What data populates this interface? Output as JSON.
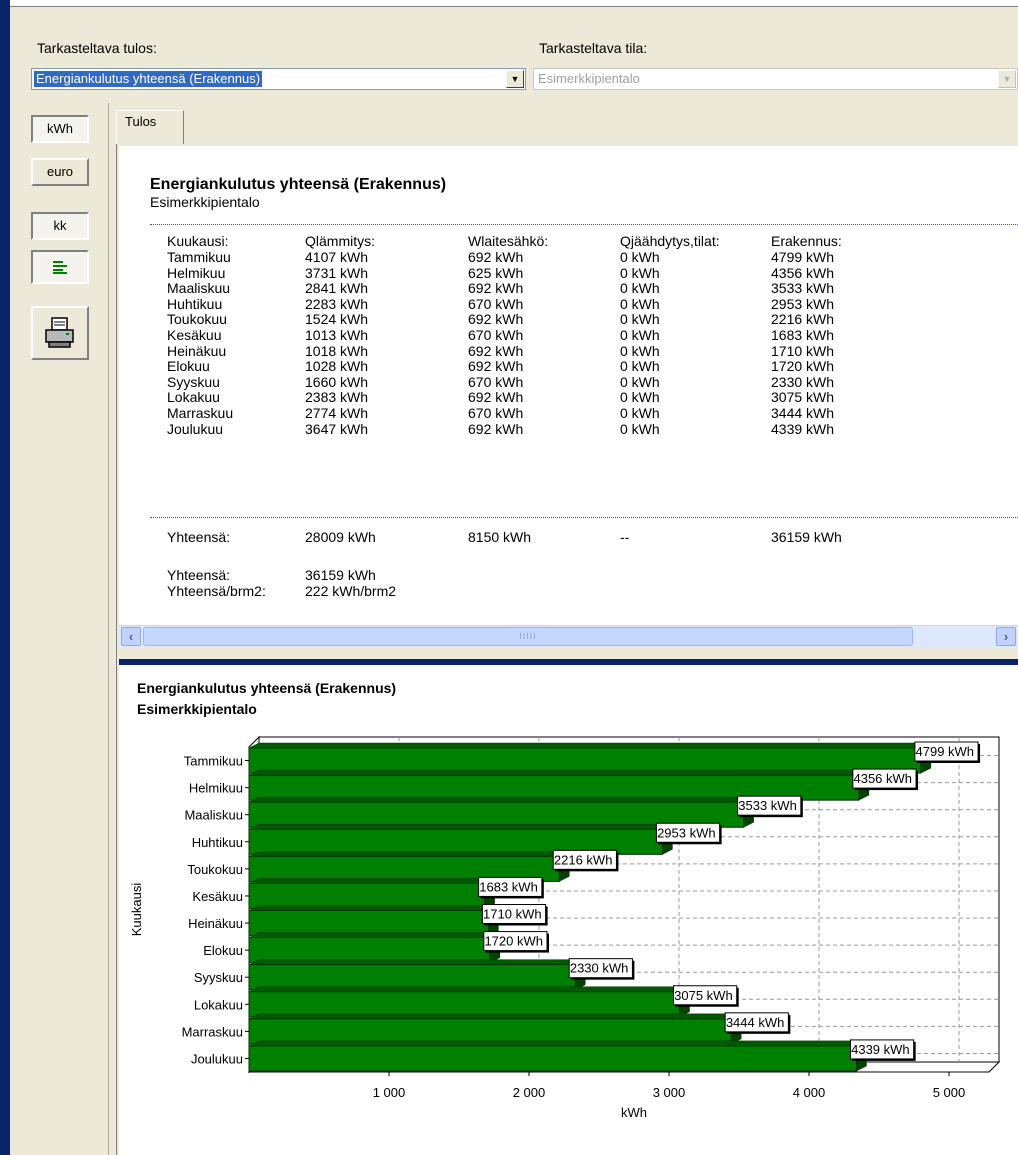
{
  "header": {
    "result_label": "Tarkasteltava tulos:",
    "result_value": "Energiankulutus yhteensä (Erakennus)",
    "space_label": "Tarkasteltava tila:",
    "space_value": "Esimerkkipientalo"
  },
  "sidebar": {
    "kwh_label": "kWh",
    "euro_label": "euro",
    "kk_label": "kk"
  },
  "tab": {
    "label": "Tulos"
  },
  "table": {
    "title": "Energiankulutus yhteensä (Erakennus)",
    "subtitle": "Esimerkkipientalo",
    "headers": [
      "Kuukausi:",
      "Qlämmitys:",
      "Wlaitesähkö:",
      "Qjäähdytys,tilat:",
      "Erakennus:"
    ],
    "rows": [
      [
        "Tammikuu",
        "4107 kWh",
        "692 kWh",
        "0 kWh",
        "4799 kWh"
      ],
      [
        "Helmikuu",
        "3731 kWh",
        "625 kWh",
        "0 kWh",
        "4356 kWh"
      ],
      [
        "Maaliskuu",
        "2841 kWh",
        "692 kWh",
        "0 kWh",
        "3533 kWh"
      ],
      [
        "Huhtikuu",
        "2283 kWh",
        "670 kWh",
        "0 kWh",
        "2953 kWh"
      ],
      [
        "Toukokuu",
        "1524 kWh",
        "692 kWh",
        "0 kWh",
        "2216 kWh"
      ],
      [
        "Kesäkuu",
        "1013 kWh",
        "670 kWh",
        "0 kWh",
        "1683 kWh"
      ],
      [
        "Heinäkuu",
        "1018 kWh",
        "692 kWh",
        "0 kWh",
        "1710 kWh"
      ],
      [
        "Elokuu",
        "1028 kWh",
        "692 kWh",
        "0 kWh",
        "1720 kWh"
      ],
      [
        "Syyskuu",
        "1660 kWh",
        "670 kWh",
        "0 kWh",
        "2330 kWh"
      ],
      [
        "Lokakuu",
        "2383 kWh",
        "692 kWh",
        "0 kWh",
        "3075 kWh"
      ],
      [
        "Marraskuu",
        "2774 kWh",
        "670 kWh",
        "0 kWh",
        "3444 kWh"
      ],
      [
        "Joulukuu",
        "3647 kWh",
        "692 kWh",
        "0 kWh",
        "4339 kWh"
      ]
    ],
    "total_row": [
      "Yhteensä:",
      "28009 kWh",
      "8150 kWh",
      "--",
      "36159 kWh"
    ],
    "summary": [
      [
        "Yhteensä:",
        "36159 kWh"
      ],
      [
        "Yhteensä/brm2:",
        "222 kWh/brm2"
      ]
    ]
  },
  "scrollbar": {
    "grip": "IIIII"
  },
  "chart_data": {
    "type": "bar",
    "orientation": "horizontal",
    "title": "Energiankulutus yhteensä (Erakennus)",
    "subtitle": "Esimerkkipientalo",
    "xlabel": "kWh",
    "ylabel": "Kuukausi",
    "categories": [
      "Tammikuu",
      "Helmikuu",
      "Maaliskuu",
      "Huhtikuu",
      "Toukokuu",
      "Kesäkuu",
      "Heinäkuu",
      "Elokuu",
      "Syyskuu",
      "Lokakuu",
      "Marraskuu",
      "Joulukuu"
    ],
    "values": [
      4799,
      4356,
      3533,
      2953,
      2216,
      1683,
      1710,
      1720,
      2330,
      3075,
      3444,
      4339
    ],
    "data_labels": [
      "4799 kWh",
      "4356 kWh",
      "3533 kWh",
      "2953 kWh",
      "2216 kWh",
      "1683 kWh",
      "1710 kWh",
      "1720 kWh",
      "2330 kWh",
      "3075 kWh",
      "3444 kWh",
      "4339 kWh"
    ],
    "xticks": [
      1000,
      2000,
      3000,
      4000,
      5000
    ],
    "xtick_labels": [
      "1 000",
      "2 000",
      "3 000",
      "4 000",
      "5 000"
    ],
    "xlim": [
      0,
      5000
    ],
    "grid": true,
    "bar_color": "#008000"
  },
  "colors": {
    "titlebar": "#0a246a",
    "selection": "#316ac5",
    "bar": "#008000"
  }
}
